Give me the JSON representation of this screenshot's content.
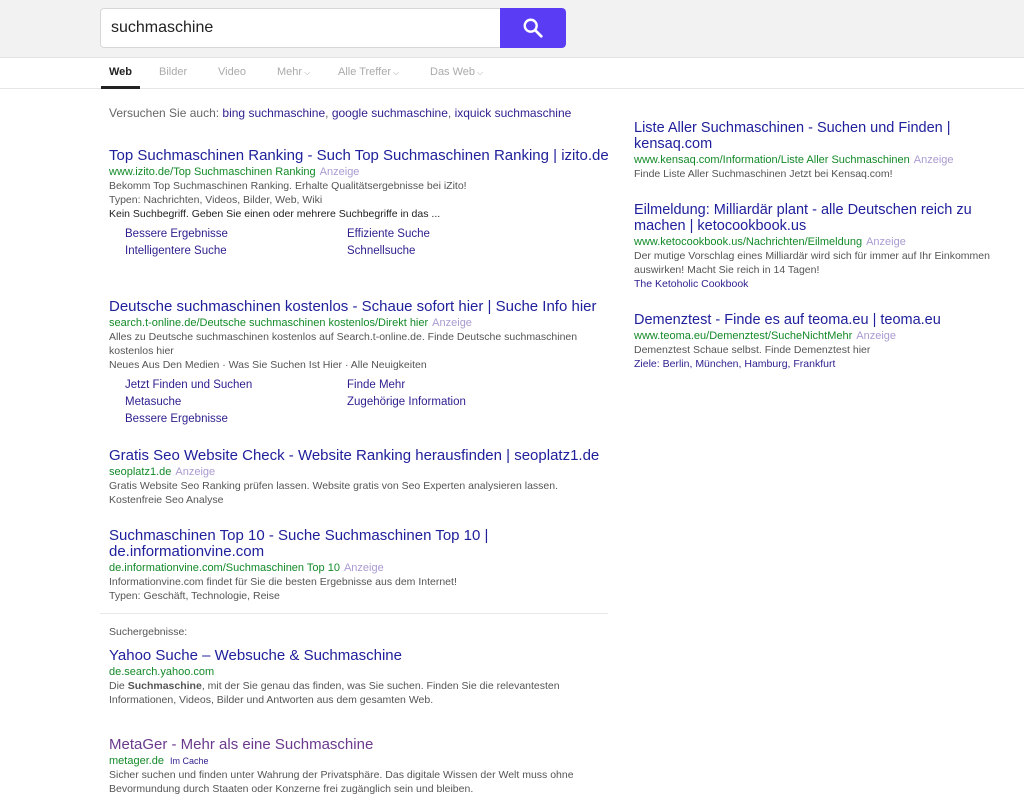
{
  "search": {
    "query": "suchmaschine"
  },
  "tabs": [
    {
      "label": "Web"
    },
    {
      "label": "Bilder"
    },
    {
      "label": "Video"
    },
    {
      "label": "Mehr"
    },
    {
      "label": "Alle Treffer"
    },
    {
      "label": "Das Web"
    }
  ],
  "try_also": {
    "prefix": "Versuchen Sie auch:",
    "links": [
      "bing suchmaschine",
      "google suchmaschine",
      "ixquick suchmaschine"
    ]
  },
  "ad_label": "Anzeige",
  "ads_left": [
    {
      "title": "Top Suchmaschinen Ranking - Such Top Suchmaschinen Ranking | izito.de",
      "url": "www.izito.de/Top Suchmaschinen Ranking",
      "desc": [
        "Bekomm Top Suchmaschinen Ranking. Erhalte Qualitätsergebnisse bei iZito!",
        "Typen: Nachrichten, Videos, Bilder, Web, Wiki"
      ],
      "note": "Kein Suchbegriff. Geben Sie einen oder mehrere Suchbegriffe in das ...",
      "sitelinks": [
        "Bessere Ergebnisse",
        "Effiziente Suche",
        "Intelligentere Suche",
        "Schnellsuche"
      ]
    },
    {
      "title": "Deutsche suchmaschinen kostenlos - Schaue sofort hier | Suche Info hier",
      "url": "search.t-online.de/Deutsche suchmaschinen kostenlos/Direkt hier",
      "desc": [
        "Alles zu Deutsche suchmaschinen kostenlos auf Search.t-online.de. Finde Deutsche suchmaschinen kostenlos hier",
        "Neues Aus Den Medien · Was Sie Suchen Ist Hier · Alle Neuigkeiten"
      ],
      "sitelinks": [
        "Jetzt Finden und Suchen",
        "Finde Mehr",
        "Metasuche",
        "Zugehörige Information",
        "Bessere Ergebnisse"
      ]
    },
    {
      "title": "Gratis Seo Website Check - Website Ranking herausfinden | seoplatz1.de",
      "url": "seoplatz1.de",
      "desc": [
        "Gratis Website Seo Ranking prüfen lassen. Website gratis von Seo Experten analysieren lassen. Kostenfreie Seo Analyse"
      ]
    },
    {
      "title": "Suchmaschinen Top 10 - Suche Suchmaschinen Top 10 | de.informationvine.com",
      "url": "de.informationvine.com/Suchmaschinen Top 10",
      "desc": [
        "Informationvine.com findet für Sie die besten Ergebnisse aus dem Internet!",
        "Typen: Geschäft, Technologie, Reise"
      ]
    }
  ],
  "organic_label": "Suchergebnisse:",
  "organic": [
    {
      "title": "Yahoo Suche – Websuche & Suchmaschine",
      "url": "de.search.yahoo.com",
      "desc_before": "Die ",
      "desc_bold": "Suchmaschine",
      "desc_after": ", mit der Sie genau das finden, was Sie suchen. Finden Sie die relevantesten Informationen, Videos, Bilder und Antworten aus dem gesamten Web."
    },
    {
      "title": "MetaGer - Mehr als eine Suchmaschine",
      "url": "metager.de",
      "cache": "Im Cache",
      "desc": "Sicher suchen und finden unter Wahrung der Privatsphäre. Das digitale Wissen der Welt muss ohne Bevormundung durch Staaten oder Konzerne frei zugänglich sein und bleiben."
    }
  ],
  "ads_right": [
    {
      "title": "Liste Aller Suchmaschinen - Suchen und Finden | kensaq.com",
      "url": "www.kensaq.com/Information/Liste Aller Suchmaschinen",
      "desc": "Finde Liste Aller Suchmaschinen Jetzt bei Kensaq.com!"
    },
    {
      "title": "Eilmeldung: Milliardär plant - alle Deutschen reich zu machen | ketocookbook.us",
      "url": "www.ketocookbook.us/Nachrichten/Eilmeldung",
      "desc": "Der mutige Vorschlag eines Milliardär wird sich für immer auf Ihr Einkommen auswirken! Macht Sie reich in 14 Tagen!",
      "sub": "The Ketoholic Cookbook"
    },
    {
      "title": "Demenztest - Finde es auf teoma.eu | teoma.eu",
      "url": "www.teoma.eu/Demenztest/SucheNichtMehr",
      "desc": "Demenztest Schaue selbst. Finde Demenztest hier",
      "sub_prefix": "Ziele:",
      "sub_links": [
        "Berlin",
        "München",
        "Hamburg",
        "Frankfurt"
      ]
    }
  ],
  "colors": {
    "accent": "#5b3cf5",
    "link": "#20209c",
    "url": "#138a28",
    "ad": "#a99bd1"
  }
}
